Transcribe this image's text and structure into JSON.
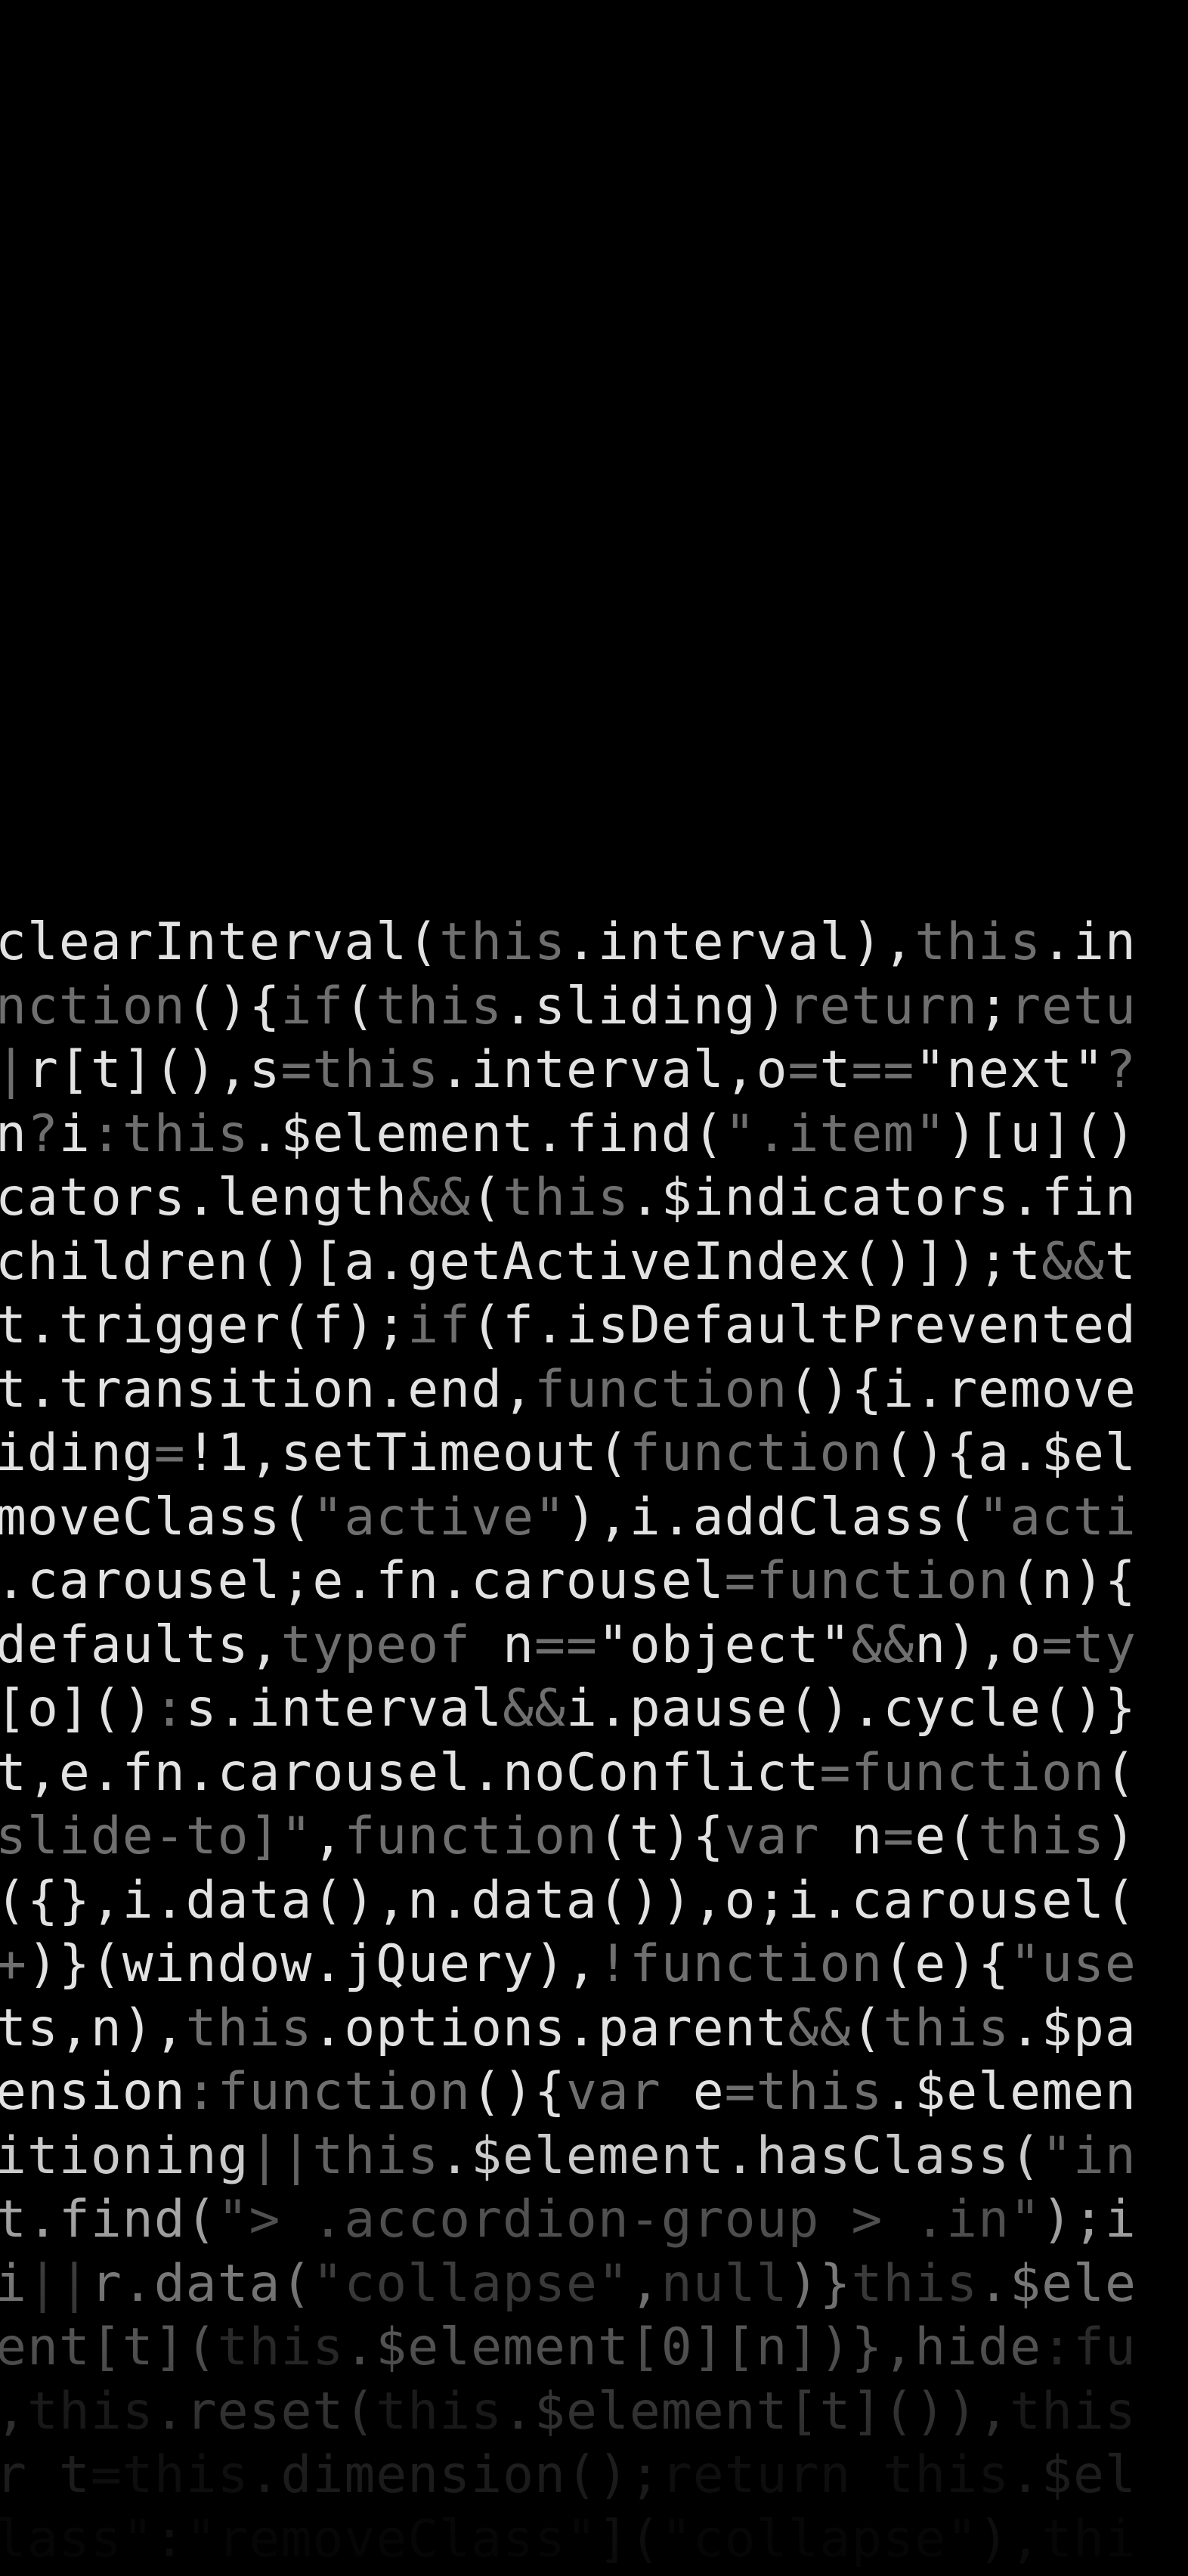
{
  "colors": {
    "background": "#000000",
    "plain_text": "#e2e2e2",
    "keyword_text": "#6f6f6f"
  },
  "code_lines": [
    [
      [
        "clearInterval(",
        "p"
      ],
      [
        "this",
        "k"
      ],
      [
        ".interval),",
        "p"
      ],
      [
        "this",
        "k"
      ],
      [
        ".in",
        "p"
      ]
    ],
    [
      [
        "nction",
        "k"
      ],
      [
        "(){",
        "p"
      ],
      [
        "if",
        "k"
      ],
      [
        "(",
        "p"
      ],
      [
        "this",
        "k"
      ],
      [
        ".sliding)",
        "p"
      ],
      [
        "return",
        "k"
      ],
      [
        ";",
        "p"
      ],
      [
        "retu",
        "k"
      ]
    ],
    [
      [
        "|",
        "k"
      ],
      [
        "r[t](),s",
        "p"
      ],
      [
        "=",
        "k"
      ],
      [
        "this",
        "k"
      ],
      [
        ".interval,o",
        "p"
      ],
      [
        "=",
        "k"
      ],
      [
        "t",
        "p"
      ],
      [
        "==",
        "k"
      ],
      [
        "\"next\"",
        "p"
      ],
      [
        "?",
        "k"
      ]
    ],
    [
      [
        "n",
        "p"
      ],
      [
        "?",
        "k"
      ],
      [
        "i",
        "p"
      ],
      [
        ":",
        "k"
      ],
      [
        "this",
        "k"
      ],
      [
        ".$element.find(",
        "p"
      ],
      [
        "\".item\"",
        "k"
      ],
      [
        ")[u]()",
        "p"
      ]
    ],
    [
      [
        "cators.length",
        "p"
      ],
      [
        "&&",
        "k"
      ],
      [
        "(",
        "p"
      ],
      [
        "this",
        "k"
      ],
      [
        ".$indicators.fin",
        "p"
      ]
    ],
    [
      [
        "children()[a.getActiveIndex()]);t",
        "p"
      ],
      [
        "&&",
        "k"
      ],
      [
        "t",
        "p"
      ]
    ],
    [
      [
        "t.trigger(f);",
        "p"
      ],
      [
        "if",
        "k"
      ],
      [
        "(f.isDefaultPrevented",
        "p"
      ]
    ],
    [
      [
        "t.transition.end,",
        "p"
      ],
      [
        "function",
        "k"
      ],
      [
        "(){i.remove",
        "p"
      ]
    ],
    [
      [
        "iding",
        "p"
      ],
      [
        "=",
        "k"
      ],
      [
        "!1,setTimeout(",
        "p"
      ],
      [
        "function",
        "k"
      ],
      [
        "(){a.$el",
        "p"
      ]
    ],
    [
      [
        "moveClass(",
        "p"
      ],
      [
        "\"active\"",
        "k"
      ],
      [
        "),i.addClass(",
        "p"
      ],
      [
        "\"acti",
        "k"
      ]
    ],
    [
      [
        ".carousel;e.fn.carousel",
        "p"
      ],
      [
        "=",
        "k"
      ],
      [
        "function",
        "k"
      ],
      [
        "(n){",
        "p"
      ]
    ],
    [
      [
        "defaults,",
        "p"
      ],
      [
        "typeof",
        "k"
      ],
      [
        " n",
        "p"
      ],
      [
        "==",
        "k"
      ],
      [
        "\"object\"",
        "p"
      ],
      [
        "&&",
        "k"
      ],
      [
        "n),o",
        "p"
      ],
      [
        "=",
        "k"
      ],
      [
        "ty",
        "k"
      ]
    ],
    [
      [
        "[o]()",
        "p"
      ],
      [
        ":",
        "k"
      ],
      [
        "s.interval",
        "p"
      ],
      [
        "&&",
        "k"
      ],
      [
        "i.pause().cycle()}",
        "p"
      ]
    ],
    [
      [
        "t,e.fn.carousel.noConflict",
        "p"
      ],
      [
        "=",
        "k"
      ],
      [
        "function",
        "k"
      ],
      [
        "(",
        "p"
      ]
    ],
    [
      [
        "slide-to]\"",
        "k"
      ],
      [
        ",",
        "p"
      ],
      [
        "function",
        "k"
      ],
      [
        "(t){",
        "p"
      ],
      [
        "var",
        "k"
      ],
      [
        " n",
        "p"
      ],
      [
        "=",
        "k"
      ],
      [
        "e(",
        "p"
      ],
      [
        "this",
        "k"
      ],
      [
        ")",
        "p"
      ]
    ],
    [
      [
        "({},i.data(),n.data()),o;i.carousel(",
        "p"
      ]
    ],
    [
      [
        "+",
        "k"
      ],
      [
        ")}(window.jQuery),",
        "p"
      ],
      [
        "!function",
        "k"
      ],
      [
        "(e){",
        "p"
      ],
      [
        "\"use",
        "k"
      ]
    ],
    [
      [
        "ts,n),",
        "p"
      ],
      [
        "this",
        "k"
      ],
      [
        ".options.parent",
        "p"
      ],
      [
        "&&",
        "k"
      ],
      [
        "(",
        "p"
      ],
      [
        "this",
        "k"
      ],
      [
        ".$pa",
        "p"
      ]
    ],
    [
      [
        "ension",
        "p"
      ],
      [
        ":function",
        "k"
      ],
      [
        "(){",
        "p"
      ],
      [
        "var",
        "k"
      ],
      [
        " e",
        "p"
      ],
      [
        "=",
        "k"
      ],
      [
        "this",
        "k"
      ],
      [
        ".$elemen",
        "p"
      ]
    ],
    [
      [
        "itioning",
        "p"
      ],
      [
        "||",
        "k"
      ],
      [
        "this",
        "k"
      ],
      [
        ".$element.hasClass(",
        "p"
      ],
      [
        "\"in",
        "k"
      ]
    ],
    [
      [
        "t.find(",
        "p"
      ],
      [
        "\"> .accordion-group > .in\"",
        "k"
      ],
      [
        ");i",
        "p"
      ]
    ],
    [
      [
        "i",
        "p"
      ],
      [
        "||",
        "k"
      ],
      [
        "r.data(",
        "p"
      ],
      [
        "\"collapse\"",
        "k"
      ],
      [
        ",",
        "p"
      ],
      [
        "null",
        "k"
      ],
      [
        ")}",
        "p"
      ],
      [
        "this",
        "k"
      ],
      [
        ".$ele",
        "p"
      ]
    ],
    [
      [
        "ent[t](",
        "p"
      ],
      [
        "this",
        "k"
      ],
      [
        ".$element[0][n])},hide",
        "p"
      ],
      [
        ":fu",
        "k"
      ]
    ],
    [
      [
        ",",
        "p"
      ],
      [
        "this",
        "k"
      ],
      [
        ".reset(",
        "p"
      ],
      [
        "this",
        "k"
      ],
      [
        ".$element[t]()),",
        "p"
      ],
      [
        "this",
        "k"
      ]
    ],
    [
      [
        "r t",
        "p"
      ],
      [
        "=",
        "k"
      ],
      [
        "this",
        "k"
      ],
      [
        ".dimension();",
        "p"
      ],
      [
        "return",
        "k"
      ],
      [
        " this",
        "k"
      ],
      [
        ".$el",
        "p"
      ]
    ],
    [
      [
        "lass\"",
        "k"
      ],
      [
        ":",
        "p"
      ],
      [
        "\"removeClass\"",
        "k"
      ],
      [
        "](",
        "p"
      ],
      [
        "\"collapse\"",
        "k"
      ],
      [
        "),",
        "p"
      ],
      [
        "thi",
        "k"
      ]
    ]
  ]
}
